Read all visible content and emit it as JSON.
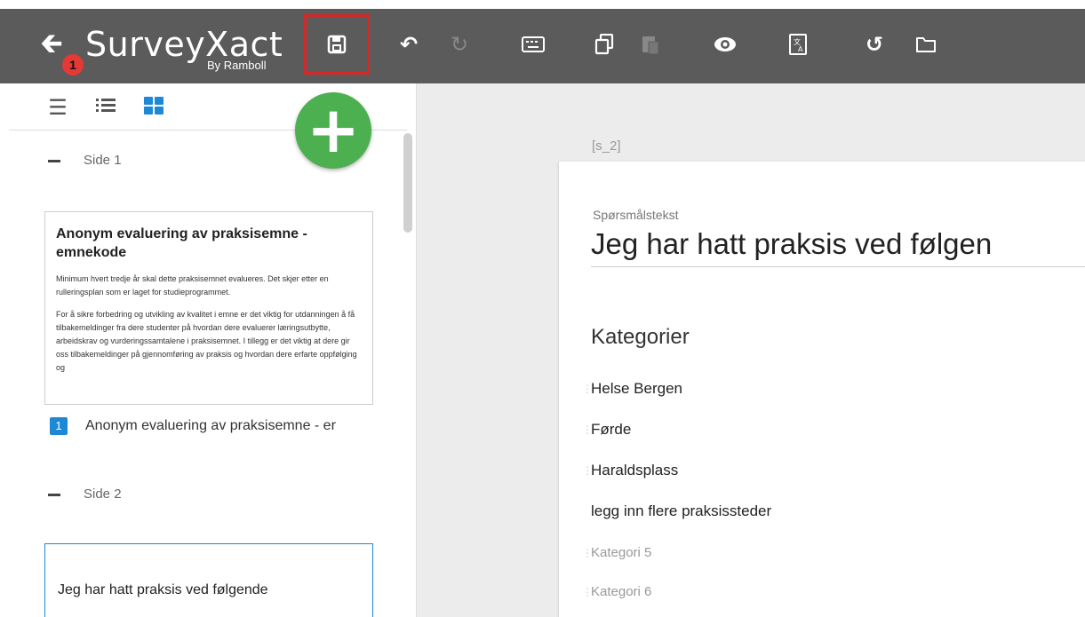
{
  "header": {
    "logo_main": "SurveyXact",
    "logo_sub": "By Ramboll",
    "badge": "1"
  },
  "toolbar": {
    "icons": [
      "save-icon",
      "undo-icon",
      "redo-icon",
      "keyboard-icon",
      "copy-icon",
      "paste-icon",
      "preview-icon",
      "translate-icon",
      "history-icon",
      "folder-icon"
    ]
  },
  "sidebar": {
    "page1": {
      "label": "Side 1",
      "card_title": "Anonym evaluering av praksisemne - emnekode",
      "card_p1": "Minimum hvert tredje år skal dette praksisemnet evalueres. Det skjer etter en rulleringsplan som er laget for studieprogrammet.",
      "card_p2": "For å  sikre forbedring og utvikling av kvalitet i emne er det viktig for utdanningen å få tilbakemeldinger fra dere studenter på hvordan dere evaluerer  læringsutbytte, arbeidskrav og vurderingssamtalene i praksisemnet. I tillegg er det viktig at dere gir oss tilbakemeldinger på gjennomføring av praksis og hvordan dere erfarte oppfølging og",
      "question_number": "1",
      "question_text": "Anonym evaluering av praksisemne - er"
    },
    "page2": {
      "label": "Side 2",
      "card_text": "Jeg har hatt praksis ved følgende"
    }
  },
  "editor": {
    "question_id": "[s_2]",
    "question_label": "Spørsmålstekst",
    "question_title": "Jeg har hatt praksis ved følgen",
    "categories_heading": "Kategorier",
    "categories": [
      "Helse Bergen",
      "Førde",
      "Haraldsplass",
      "legg inn flere praksissteder"
    ],
    "placeholders": [
      "Kategori 5",
      "Kategori 6"
    ]
  }
}
